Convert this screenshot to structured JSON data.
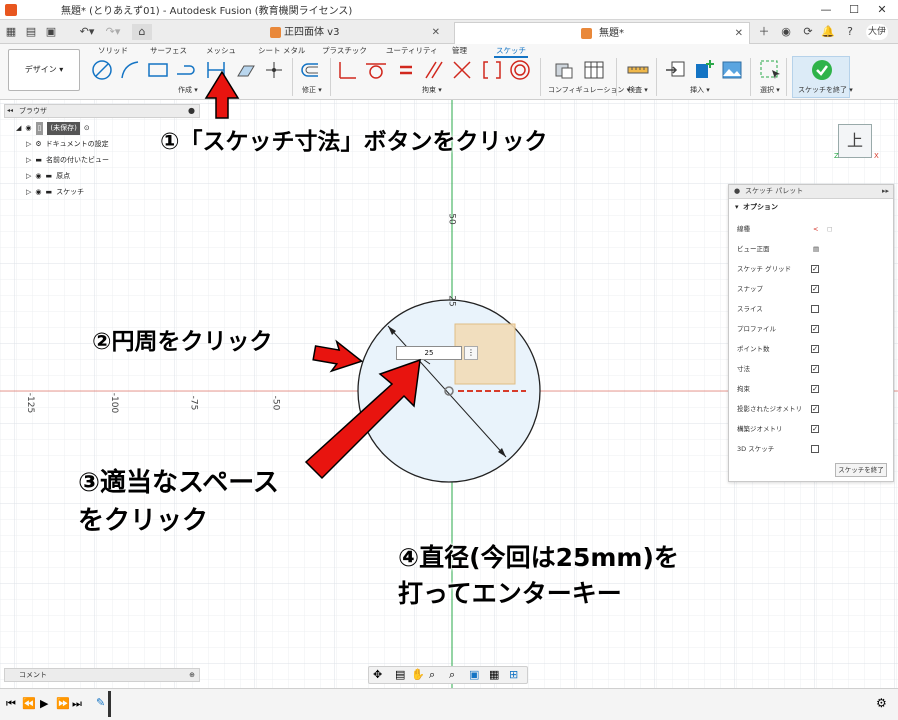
{
  "window": {
    "title": "無題* (とりあえず01) - Autodesk Fusion (教育機関ライセンス)",
    "controls": [
      "—",
      "☐",
      "✕"
    ]
  },
  "tabs": {
    "home": "⌂",
    "items": [
      {
        "label": "正四面体 v3",
        "active": false
      },
      {
        "label": "無題*",
        "active": true
      }
    ],
    "user": "大伊"
  },
  "ribbon": {
    "design_label": "デザイン ▾",
    "tabs": [
      "ソリッド",
      "サーフェス",
      "メッシュ",
      "シート メタル",
      "プラスチック",
      "ユーティリティ",
      "管理",
      "スケッチ"
    ],
    "active_tab": "スケッチ",
    "groups": [
      "作成 ▾",
      "修正 ▾",
      "拘束 ▾",
      "コンフィギュレーション ▾",
      "検査 ▾",
      "挿入 ▾",
      "選択 ▾",
      "スケッチを終了 ▾"
    ]
  },
  "browser": {
    "title": "ブラウザ",
    "items": [
      {
        "label": "(未保存)",
        "level": 0
      },
      {
        "label": "ドキュメントの設定",
        "level": 1
      },
      {
        "label": "名前の付いたビュー",
        "level": 1
      },
      {
        "label": "原点",
        "level": 1
      },
      {
        "label": "スケッチ",
        "level": 1
      }
    ]
  },
  "palette": {
    "title": "スケッチ パレット",
    "section": "オプション",
    "rows": [
      {
        "label": "線種",
        "checked": null
      },
      {
        "label": "ビュー正面",
        "checked": null
      },
      {
        "label": "スケッチ グリッド",
        "checked": true
      },
      {
        "label": "スナップ",
        "checked": true
      },
      {
        "label": "スライス",
        "checked": false
      },
      {
        "label": "プロファイル",
        "checked": true
      },
      {
        "label": "ポイント数",
        "checked": true
      },
      {
        "label": "寸法",
        "checked": true
      },
      {
        "label": "拘束",
        "checked": true
      },
      {
        "label": "投影されたジオメトリ",
        "checked": true
      },
      {
        "label": "構築ジオメトリ",
        "checked": true
      },
      {
        "label": "3D スケッチ",
        "checked": false
      }
    ],
    "finish_label": "スケッチを終了"
  },
  "viewcube": {
    "face": "上",
    "x": "X",
    "z": "Z"
  },
  "canvas": {
    "dimension_value": "25",
    "axis_labels": {
      "y50": "50",
      "y25": "25",
      "x_125": "-125",
      "x_100": "-100",
      "x_75": "-75",
      "x_50": "-50"
    }
  },
  "comment": {
    "label": "コメント"
  },
  "annotations": {
    "step1": "①「スケッチ寸法」ボタンをクリック",
    "step2": "②円周をクリック",
    "step3_line1": "③適当なスペース",
    "step3_line2": "をクリック",
    "step4_line1": "④直径(今回は25mm)を",
    "step4_line2": "打ってエンターキー"
  },
  "colors": {
    "accent": "#1474c4",
    "annotation_red": "#e8140f",
    "axis_red": "#d73b2a",
    "axis_green": "#2aa84a",
    "circle_fill": "#e9f3fb",
    "profile_fill": "#f2dcb8"
  }
}
